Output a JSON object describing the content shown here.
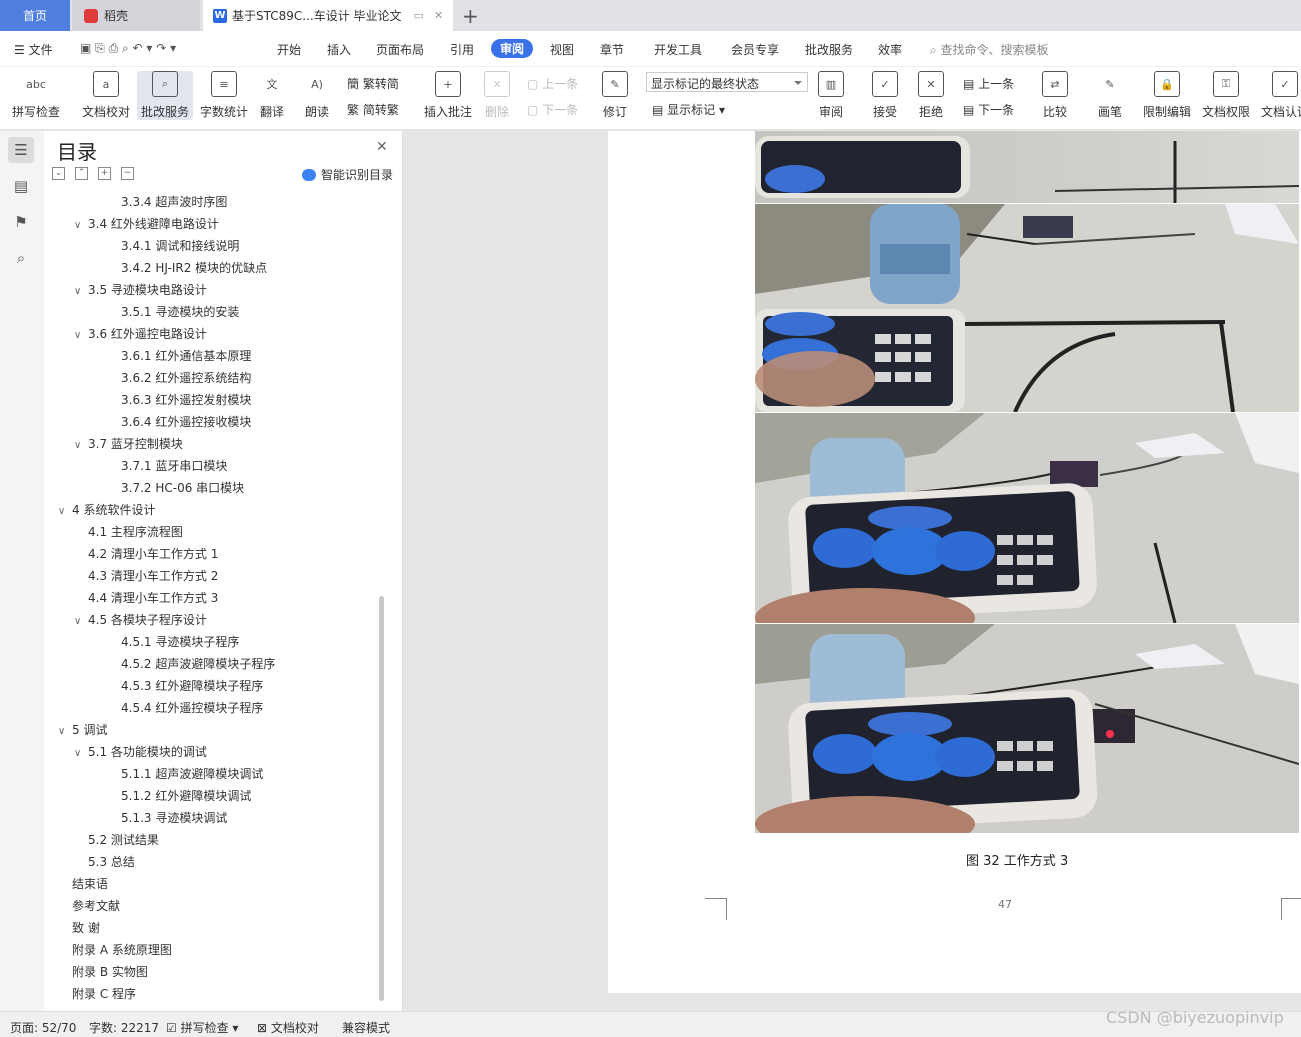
{
  "tabs": {
    "home": "首页",
    "daoke": "稻壳",
    "doc": "基于STC89C...车设计 毕业论文"
  },
  "menu": [
    "文件",
    "开始",
    "插入",
    "页面布局",
    "引用",
    "审阅",
    "视图",
    "章节",
    "开发工具",
    "会员专享",
    "批改服务",
    "效率"
  ],
  "menu_active": "审阅",
  "search_placeholder": "查找命令、搜索模板",
  "ribbon": {
    "spell": "拼写检查",
    "doc_check": "文档校对",
    "correct": "批改服务",
    "word_count": "字数统计",
    "translate": "翻译",
    "read": "朗读",
    "to_trad": "繁转简",
    "to_simp": "简转繁",
    "insert_comment": "插入批注",
    "delete": "删除",
    "prev": "上一条",
    "next": "下一条",
    "revise": "修订",
    "show_state": "显示标记的最终状态",
    "show_marks": "显示标记",
    "review": "审阅",
    "accept": "接受",
    "reject": "拒绝",
    "prev2": "上一条",
    "next2": "下一条",
    "compare": "比较",
    "pen": "画笔",
    "restrict": "限制编辑",
    "doc_perm": "文档权限",
    "doc_cert": "文档认证"
  },
  "toc": {
    "title": "目录",
    "smart": "智能识别目录",
    "items": [
      {
        "text": "3.3.4  超声波时序图",
        "level": 3
      },
      {
        "text": "3.4  红外线避障电路设计",
        "level": 2,
        "chev": true
      },
      {
        "text": "3.4.1  调试和接线说明",
        "level": 3
      },
      {
        "text": "3.4.2 HJ-IR2 模块的优缺点",
        "level": 3
      },
      {
        "text": "3.5  寻迹模块电路设计",
        "level": 2,
        "chev": true
      },
      {
        "text": "3.5.1  寻迹模块的安装",
        "level": 3
      },
      {
        "text": "3.6  红外遥控电路设计",
        "level": 2,
        "chev": true
      },
      {
        "text": "3.6.1  红外通信基本原理",
        "level": 3
      },
      {
        "text": "3.6.2  红外遥控系统结构",
        "level": 3
      },
      {
        "text": "3.6.3  红外遥控发射模块",
        "level": 3
      },
      {
        "text": "3.6.4  红外遥控接收模块",
        "level": 3
      },
      {
        "text": "3.7  蓝牙控制模块",
        "level": 2,
        "chev": true
      },
      {
        "text": "3.7.1  蓝牙串口模块",
        "level": 3
      },
      {
        "text": "3.7.2 HC-06 串口模块",
        "level": 3
      },
      {
        "text": "4  系统软件设计",
        "level": 1,
        "chev": true
      },
      {
        "text": "4.1  主程序流程图",
        "level": 2
      },
      {
        "text": "4.2  清理小车工作方式 1",
        "level": 2
      },
      {
        "text": "4.3  清理小车工作方式 2",
        "level": 2
      },
      {
        "text": "4.4  清理小车工作方式 3",
        "level": 2
      },
      {
        "text": "4.5  各模块子程序设计",
        "level": 2,
        "chev": true
      },
      {
        "text": "4.5.1  寻迹模块子程序",
        "level": 3
      },
      {
        "text": "4.5.2  超声波避障模块子程序",
        "level": 3
      },
      {
        "text": "4.5.3  红外避障模块子程序",
        "level": 3
      },
      {
        "text": "4.5.4  红外遥控模块子程序",
        "level": 3
      },
      {
        "text": "5  调试",
        "level": 1,
        "chev": true
      },
      {
        "text": "5.1  各功能模块的调试",
        "level": 2,
        "chev": true
      },
      {
        "text": "5.1.1  超声波避障模块调试",
        "level": 3
      },
      {
        "text": "5.1.2  红外避障模块调试",
        "level": 3
      },
      {
        "text": "5.1.3  寻迹模块调试",
        "level": 3
      },
      {
        "text": "5.2  测试结果",
        "level": 2
      },
      {
        "text": "5.3  总结",
        "level": 2
      },
      {
        "text": "结束语",
        "level": 1
      },
      {
        "text": "参考文献",
        "level": 1
      },
      {
        "text": "致    谢",
        "level": 1
      },
      {
        "text": "附录 A    系统原理图",
        "level": 1
      },
      {
        "text": "附录 B    实物图",
        "level": 1
      },
      {
        "text": "附录 C    程序",
        "level": 1
      }
    ]
  },
  "document": {
    "caption": "图 32  工作方式 3",
    "page_number": "47"
  },
  "status": {
    "page": "页面: 52/70",
    "words": "字数: 22217",
    "spell": "拼写检查",
    "doc_check": "文档校对",
    "compat": "兼容模式"
  },
  "watermark": "CSDN @biyezuopinvip",
  "colors": {
    "accent": "#3a73e8",
    "home_tab": "#4f7fe0"
  }
}
